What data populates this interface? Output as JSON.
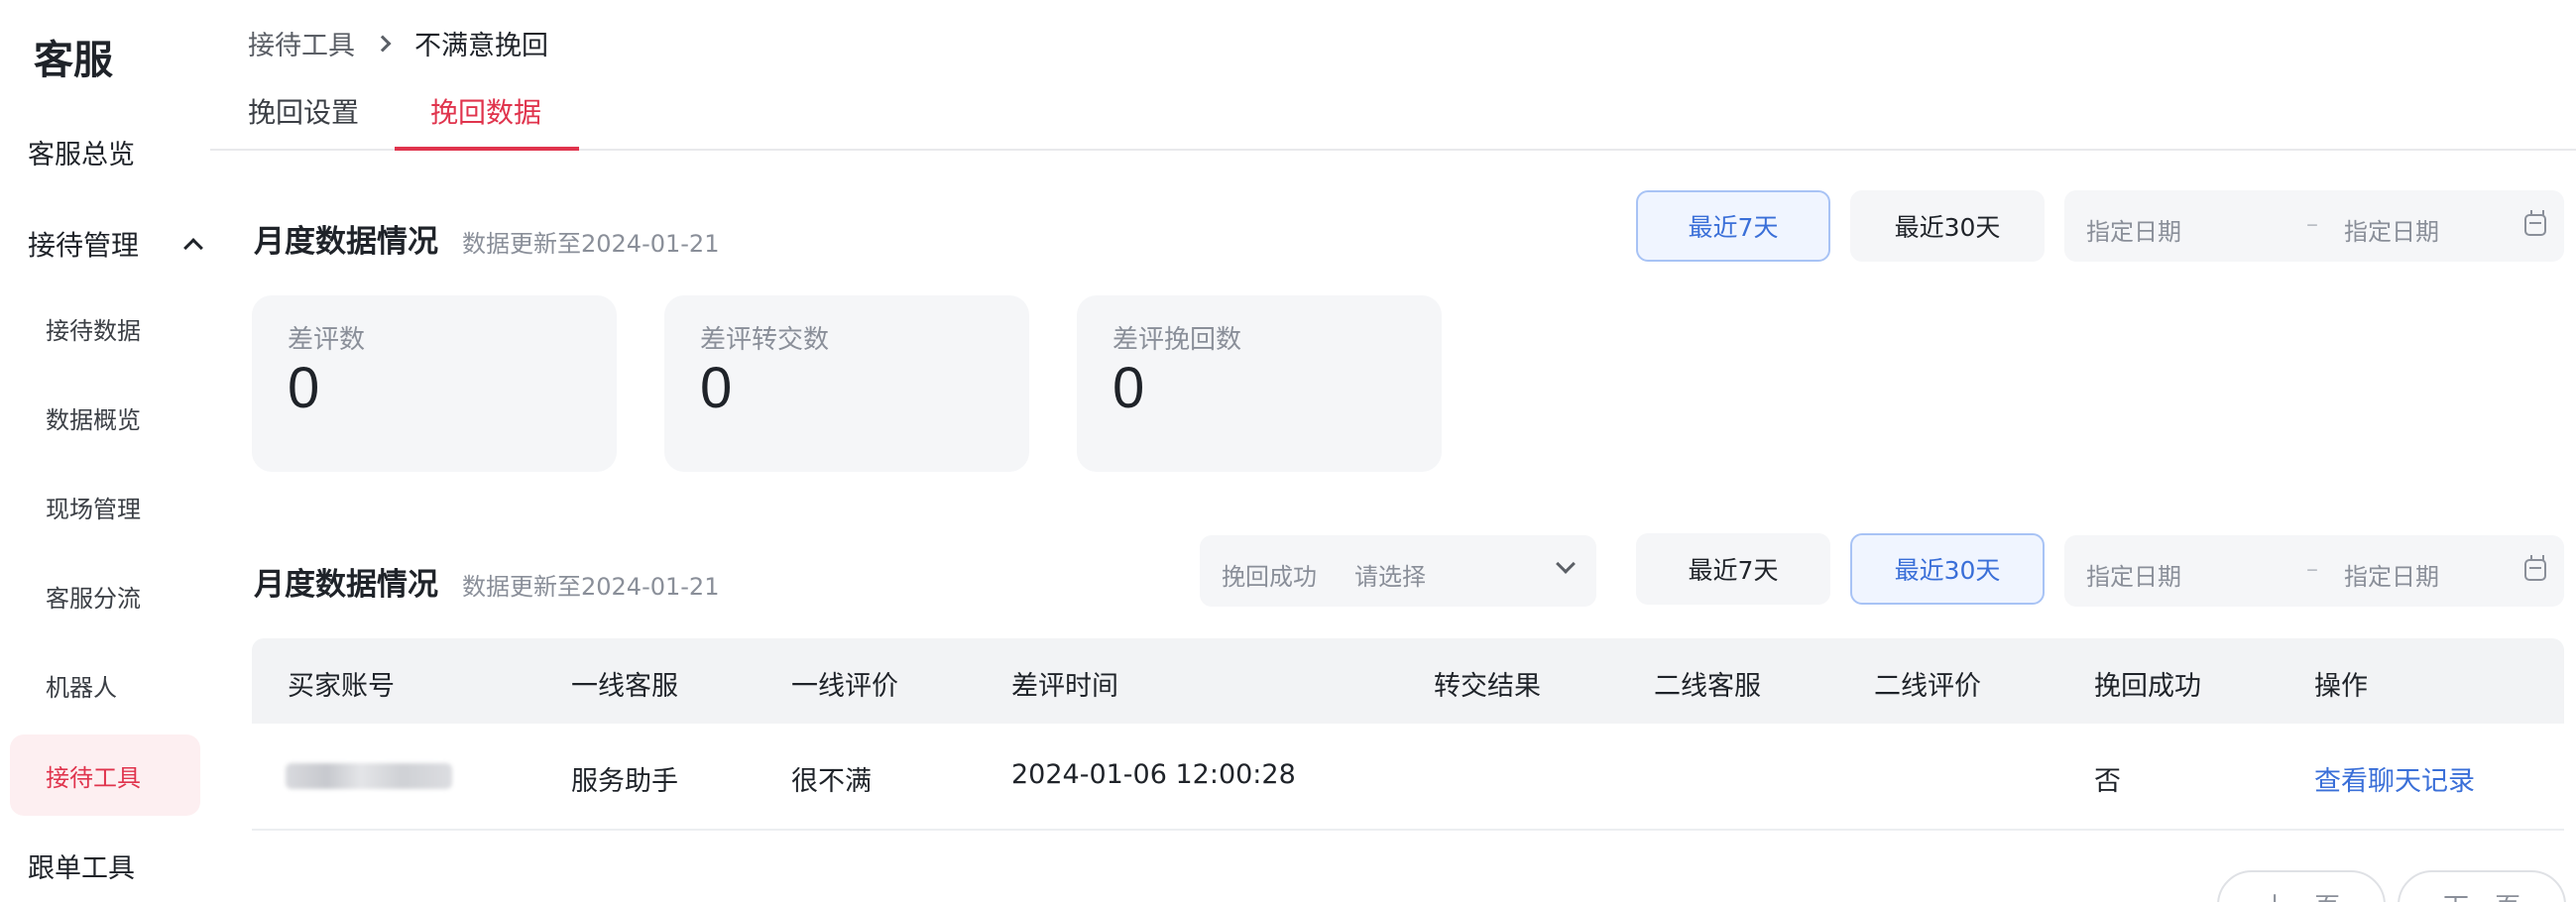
{
  "sidebar": {
    "title": "客服",
    "overview": "客服总览",
    "group": "接待管理",
    "items": [
      "接待数据",
      "数据概览",
      "现场管理",
      "客服分流",
      "机器人",
      "接待工具"
    ],
    "bottom": "跟单工具"
  },
  "breadcrumb": {
    "parent": "接待工具",
    "current": "不满意挽回"
  },
  "tabs": [
    "挽回设置",
    "挽回数据"
  ],
  "section1": {
    "title": "月度数据情况",
    "subtitle": "数据更新至2024-01-21",
    "btn7": "最近7天",
    "btn30": "最近30天",
    "date_start": "指定日期",
    "date_sep": "–",
    "date_end": "指定日期"
  },
  "stats": [
    {
      "label": "差评数",
      "value": "0"
    },
    {
      "label": "差评转交数",
      "value": "0"
    },
    {
      "label": "差评挽回数",
      "value": "0"
    }
  ],
  "section2": {
    "title": "月度数据情况",
    "subtitle": "数据更新至2024-01-21",
    "filter_label": "挽回成功",
    "filter_placeholder": "请选择",
    "btn7": "最近7天",
    "btn30": "最近30天",
    "date_start": "指定日期",
    "date_sep": "–",
    "date_end": "指定日期"
  },
  "table": {
    "columns": [
      "买家账号",
      "一线客服",
      "一线评价",
      "差评时间",
      "转交结果",
      "二线客服",
      "二线评价",
      "挽回成功",
      "操作"
    ],
    "rows": [
      {
        "agent": "服务助手",
        "rating": "很不满",
        "time": "2024-01-06 12:00:28",
        "transfer": "",
        "agent2": "",
        "rating2": "",
        "recovered": "否",
        "action": "查看聊天记录"
      }
    ]
  },
  "pagination": {
    "prev": "上一页",
    "next": "下一页"
  },
  "colors": {
    "accent": "#e0344d",
    "link": "#3a6fd8",
    "card_bg": "#f5f6f8"
  }
}
